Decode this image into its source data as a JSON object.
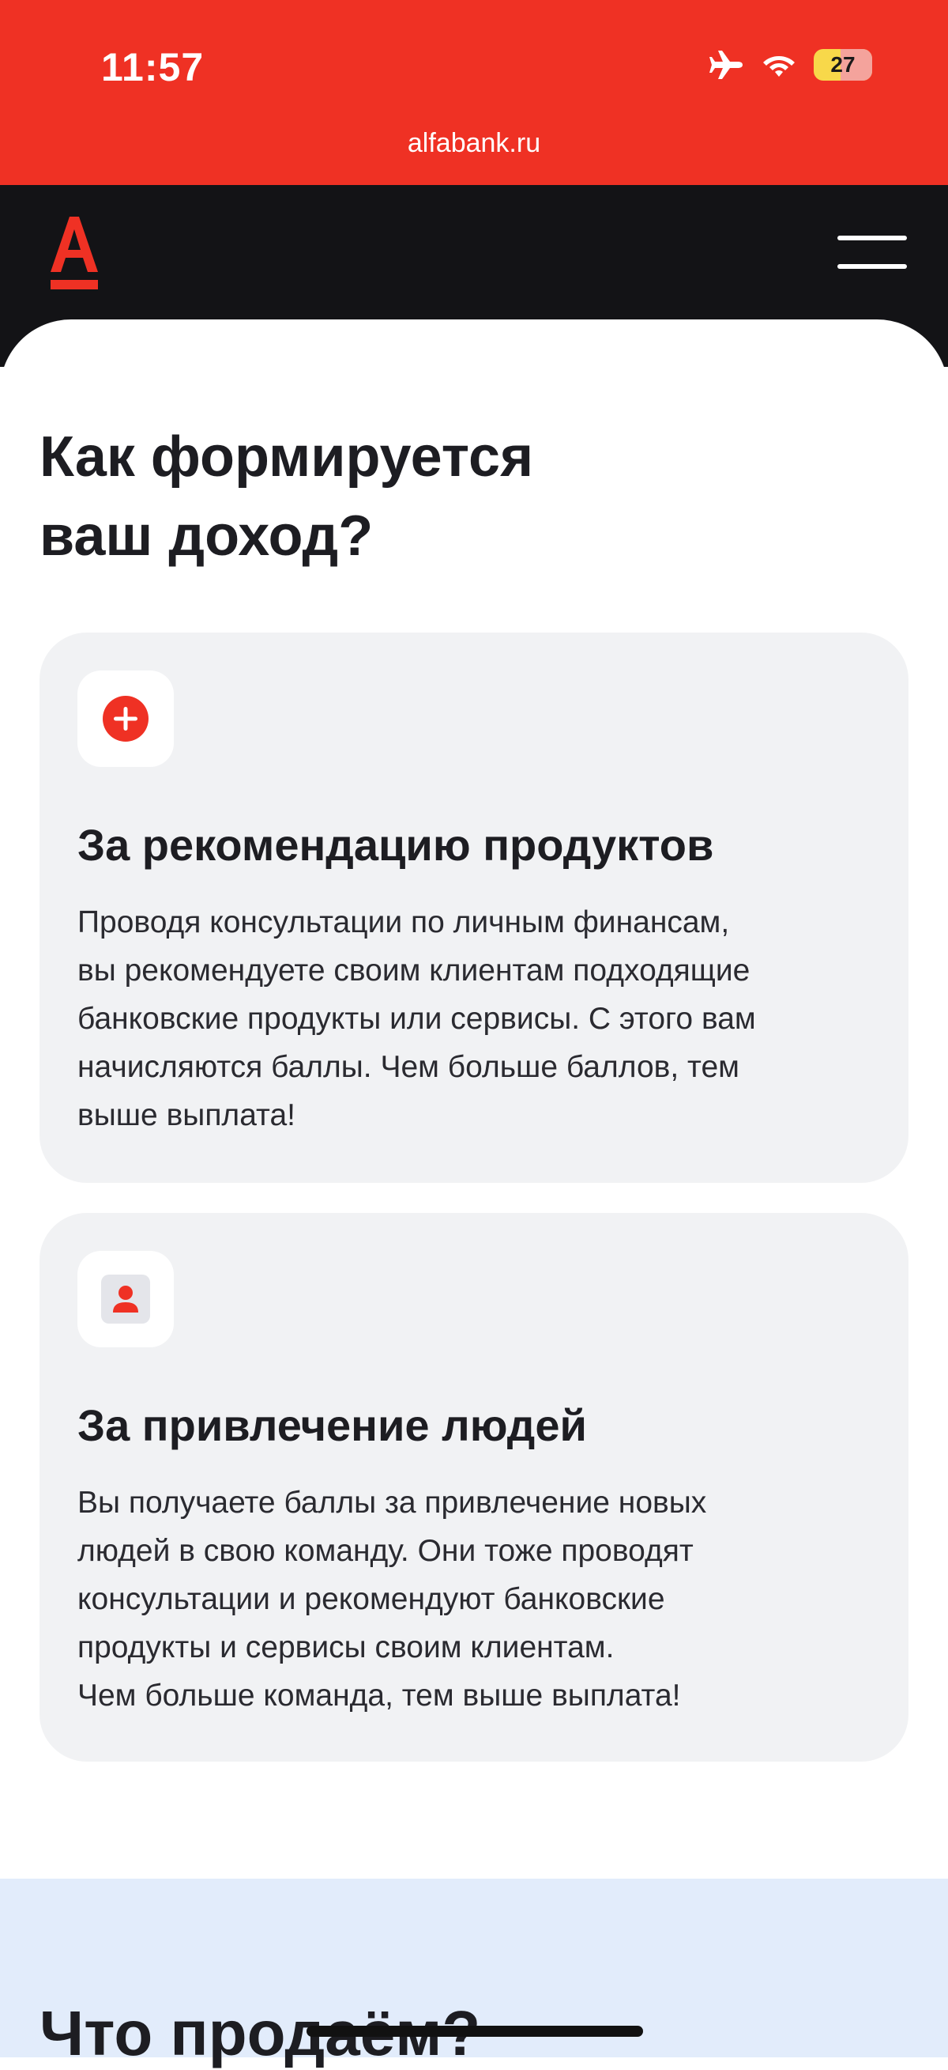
{
  "status_bar": {
    "time": "11:57",
    "battery_level": "27",
    "icons": [
      "airplane-icon",
      "wifi-icon",
      "battery-icon"
    ]
  },
  "browser": {
    "url": "alfabank.ru"
  },
  "header": {
    "logo": "А",
    "menu_icon": "hamburger-menu-icon"
  },
  "main": {
    "title": "Как формируется\nваш доход?",
    "cards": [
      {
        "icon": "plus-circle-icon",
        "title": "За рекомендацию продуктов",
        "text": "Проводя консультации по личным финансам,\nвы рекомендуете своим клиентам подходящие\nбанковские продукты или сервисы. С этого вам\nначисляются баллы. Чем больше баллов, тем\nвыше выплата!"
      },
      {
        "icon": "person-card-icon",
        "title": "За привлечение людей",
        "text": "Вы получаете баллы за привлечение новых\nлюдей в свою команду. Они тоже проводят\nконсультации и рекомендуют банковские\nпродукты и сервисы своим клиентам.\nЧем больше команда, тем выше выплата!"
      }
    ]
  },
  "next_section": {
    "title": "Что продаём?"
  },
  "colors": {
    "brand_red": "#ef3124",
    "header_dark": "#131316",
    "card_bg": "#f1f2f4",
    "section_blue": "#e2ecfb"
  }
}
